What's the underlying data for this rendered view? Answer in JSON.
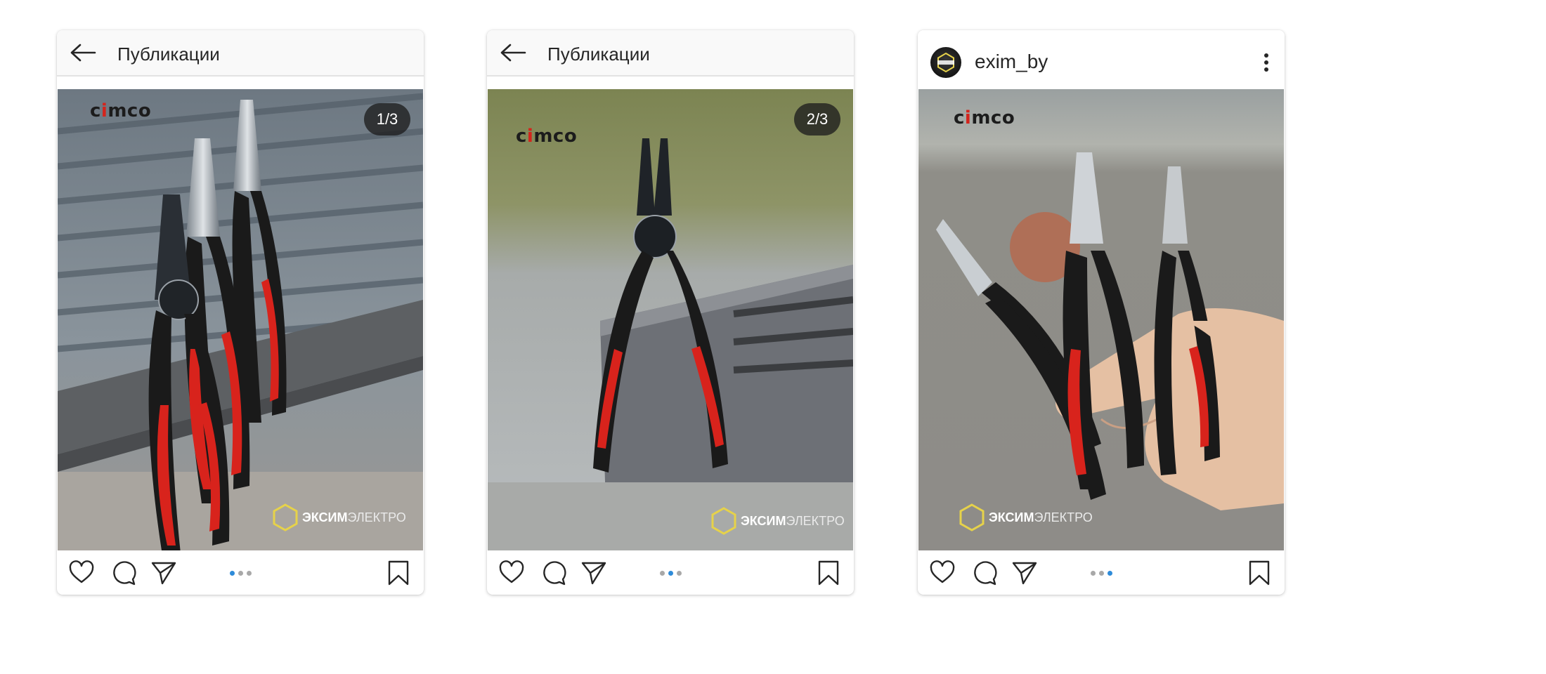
{
  "cards": [
    {
      "header": {
        "title": "Публикации"
      },
      "photo": {
        "counter": "1/3",
        "brand_top": "cimco",
        "brand_bottom_bold": "ЭКСИМ",
        "brand_bottom_light": "ЭЛЕКТРО"
      },
      "carousel": {
        "index": 1,
        "total": 3
      }
    },
    {
      "header": {
        "title": "Публикации"
      },
      "photo": {
        "counter": "2/3",
        "brand_top": "cimco",
        "brand_bottom_bold": "ЭКСИМ",
        "brand_bottom_light": "ЭЛЕКТРО"
      },
      "carousel": {
        "index": 2,
        "total": 3
      }
    },
    {
      "header": {
        "username": "exim_by"
      },
      "photo": {
        "brand_top": "cimco",
        "brand_bottom_bold": "ЭКСИМ",
        "brand_bottom_light": "ЭЛЕКТРО"
      },
      "carousel": {
        "index": 3,
        "total": 3
      }
    }
  ],
  "icons": {
    "back": "arrow-left-icon",
    "more": "more-vertical-icon",
    "like": "heart-icon",
    "comment": "comment-icon",
    "share": "send-icon",
    "save": "bookmark-icon"
  },
  "colors": {
    "accent_dot": "#2e8bd9",
    "plier_handle_red": "#d8231c",
    "plier_handle_black": "#1a1a1a",
    "brand_exim_yellow": "#e6d24a"
  }
}
